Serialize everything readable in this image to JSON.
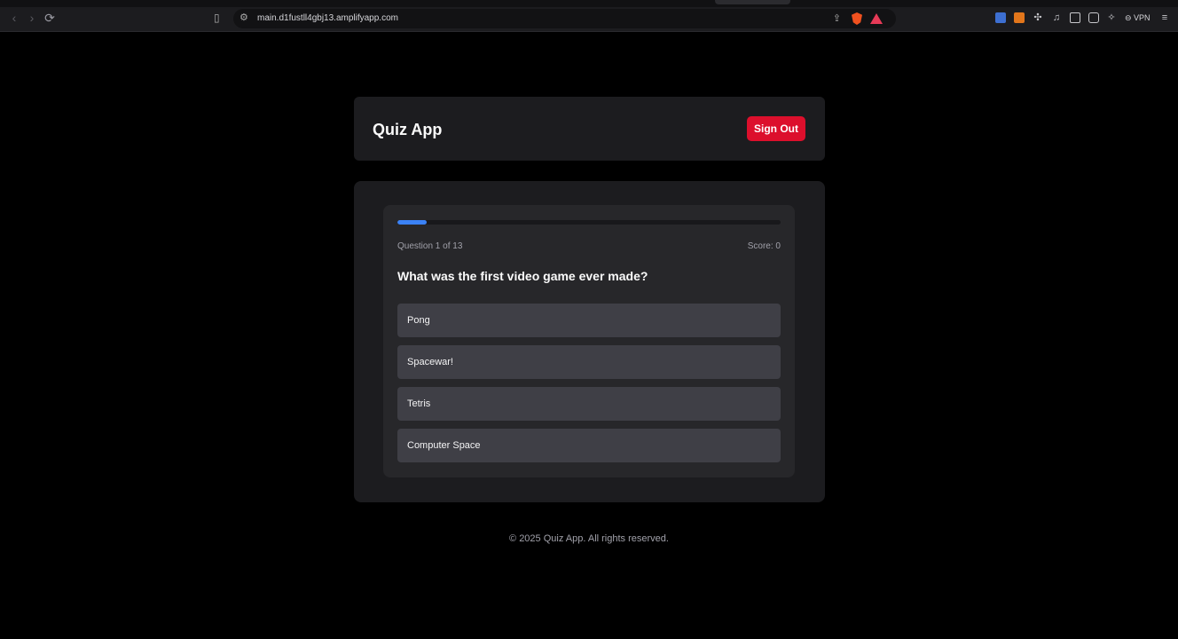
{
  "browser": {
    "url": "main.d1fustll4gbj13.amplifyapp.com",
    "vpn_label": "VPN"
  },
  "header": {
    "title": "Quiz App",
    "signout_label": "Sign Out"
  },
  "quiz": {
    "progress_fraction": 0.077,
    "question_counter": "Question 1 of 13",
    "score": "Score: 0",
    "question": "What was the first video game ever made?",
    "options": [
      "Pong",
      "Spacewar!",
      "Tetris",
      "Computer Space"
    ]
  },
  "footer": {
    "text": "© 2025 Quiz App. All rights reserved."
  },
  "colors": {
    "accent": "#3b82f6",
    "signout": "#dc0f2c",
    "background": "#000000"
  }
}
